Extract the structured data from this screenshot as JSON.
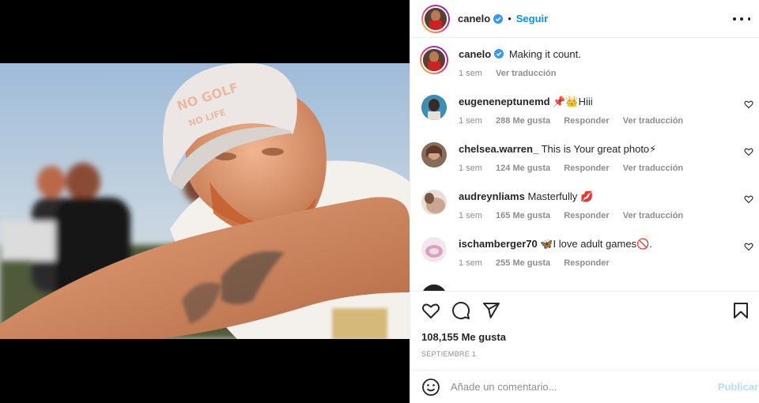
{
  "post": {
    "username": "canelo",
    "follow_label": "Seguir",
    "dot": "•",
    "caption": {
      "username": "canelo",
      "text": "Making it count.",
      "time": "1 sem",
      "translate": "Ver traducción"
    },
    "photo": {
      "cap_text_line1": "NO GOLF",
      "cap_text_line2": "NO LIFE"
    },
    "comments": [
      {
        "username": "eugeneneptunemd",
        "text": "Hiii",
        "emoji": "📌👑",
        "time": "1 sem",
        "likes": "288 Me gusta",
        "reply": "Responder",
        "translate": "Ver traducción",
        "avatar_color": "#4a9fbf"
      },
      {
        "username": "chelsea.warren_",
        "text": "This is Your great photo",
        "emoji_after": "⚡",
        "time": "1 sem",
        "likes": "124 Me gusta",
        "reply": "Responder",
        "translate": "Ver traducción",
        "avatar_color": "#8a6a58"
      },
      {
        "username": "audreynliams",
        "text": "Masterfully",
        "emoji_after": "💋",
        "time": "1 sem",
        "likes": "165 Me gusta",
        "reply": "Responder",
        "translate": "Ver traducción",
        "avatar_color": "#c9a593"
      },
      {
        "username": "ischamberger70",
        "text": "I love adult games",
        "emoji_before": "🦋",
        "emoji_after": "🚫.",
        "time": "1 sem",
        "likes": "255 Me gusta",
        "reply": "Responder",
        "avatar_color": "#d8a3c0"
      }
    ],
    "likes_count": "108,155 Me gusta",
    "date": "SEPTIEMBRE 1",
    "add_comment_placeholder": "Añade un comentario...",
    "publish_label": "Publicar",
    "colors": {
      "accent": "#0095f6",
      "publish_disabled": "#b2dffc",
      "text": "#262626",
      "muted": "#8e8e8e",
      "verified": "#3897f0"
    }
  }
}
